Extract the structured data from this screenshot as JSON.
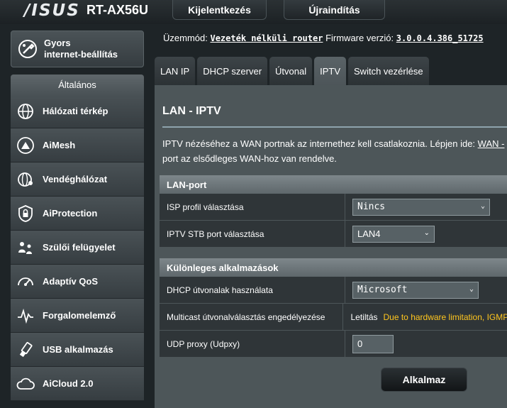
{
  "header": {
    "brand": "/ISUS",
    "model": "RT-AX56U",
    "login_button": "Kijelentkezés",
    "reboot_button": "Újraindítás"
  },
  "status": {
    "mode_label": "Üzemmód:",
    "mode_value": "Vezeték nélküli router",
    "firmware_label": "Firmware verzió:",
    "firmware_value": "3.0.0.4.386_51725"
  },
  "sidebar": {
    "quick_setup": [
      "Gyors",
      "internet-beállítás"
    ],
    "general_label": "Általános",
    "items": [
      {
        "label": "Hálózati térkép",
        "icon": "globe-network-icon"
      },
      {
        "label": "AiMesh",
        "icon": "aimesh-icon"
      },
      {
        "label": "Vendéghálózat",
        "icon": "guest-network-icon"
      },
      {
        "label": "AiProtection",
        "icon": "shield-lock-icon"
      },
      {
        "label": "Szülői felügyelet",
        "icon": "parental-control-icon"
      },
      {
        "label": "Adaptív QoS",
        "icon": "speedometer-icon"
      },
      {
        "label": "Forgalomelemző",
        "icon": "traffic-analyzer-icon"
      },
      {
        "label": "USB alkalmazás",
        "icon": "usb-icon"
      },
      {
        "label": "AiCloud 2.0",
        "icon": "cloud-icon"
      }
    ]
  },
  "tabs": [
    {
      "label": "LAN IP",
      "active": false
    },
    {
      "label": "DHCP szerver",
      "active": false
    },
    {
      "label": "Útvonal",
      "active": false
    },
    {
      "label": "IPTV",
      "active": true
    },
    {
      "label": "Switch vezérlése",
      "active": false
    }
  ],
  "main": {
    "title": "LAN - IPTV",
    "desc_line1": "IPTV nézéséhez a WAN portnak az internethez kell csatlakoznia. Lépjen ide: ",
    "desc_link": "WAN - ",
    "desc_line2": "port az elsődleges WAN-hoz van rendelve.",
    "lan_port": {
      "heading": "LAN-port",
      "isp_label": "ISP profil választása",
      "isp_value": "Nincs",
      "stb_label": "IPTV STB port választása",
      "stb_value": "LAN4"
    },
    "special": {
      "heading": "Különleges alkalmazások",
      "dhcp_label": "DHCP útvonalak használata",
      "dhcp_value": "Microsoft",
      "multicast_label": "Multicast útvonalválasztás engedélyezése",
      "multicast_value": "Letiltás",
      "multicast_warning": "Due to hardware limitation, IGMP",
      "udp_label": "UDP proxy (Udpxy)",
      "udp_value": "0"
    },
    "apply_button": "Alkalmaz"
  },
  "colors": {
    "warning": "#ffc61e",
    "panel": "#4d5659",
    "row": "#2f3538"
  }
}
